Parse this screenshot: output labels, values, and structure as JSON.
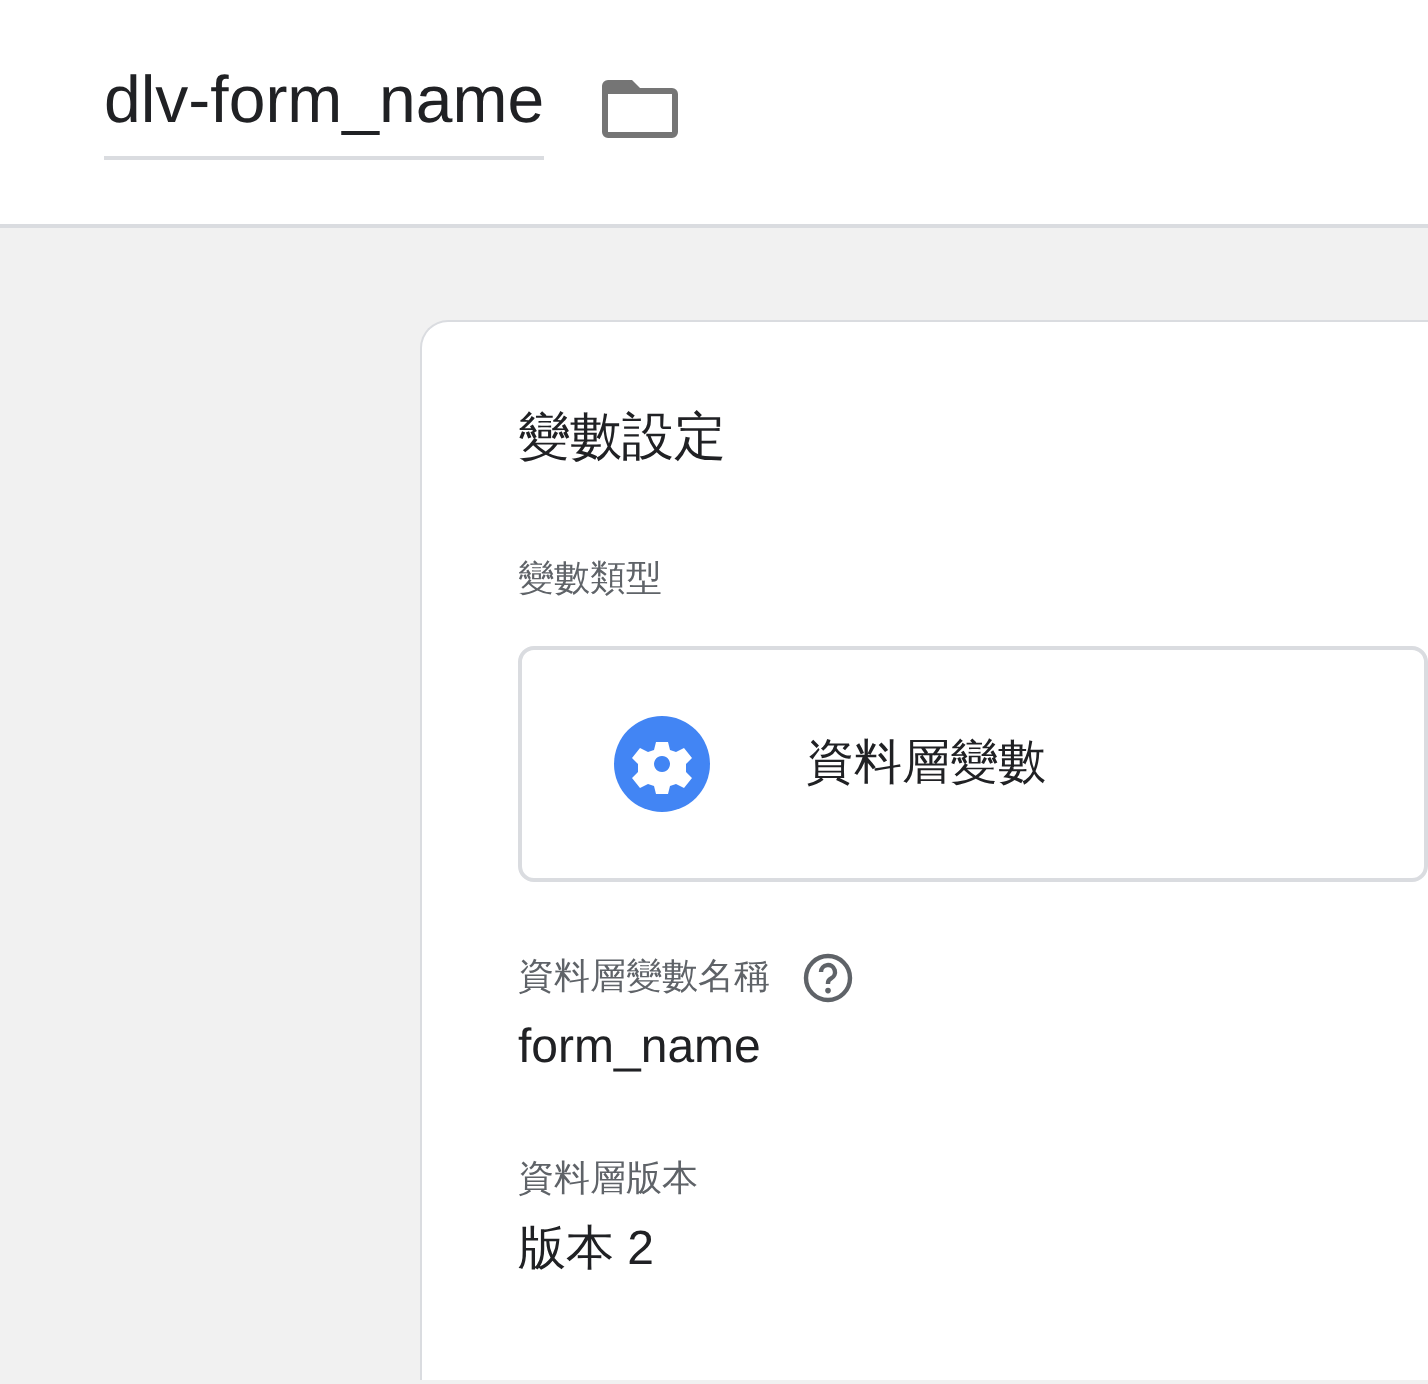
{
  "header": {
    "title": "dlv-form_name"
  },
  "settings": {
    "heading": "變數設定",
    "variable_type": {
      "label": "變數類型",
      "value": "資料層變數"
    },
    "fields": [
      {
        "label": "資料層變數名稱",
        "has_help": true,
        "value": "form_name"
      },
      {
        "label": "資料層版本",
        "has_help": false,
        "value": "版本 2"
      }
    ]
  }
}
